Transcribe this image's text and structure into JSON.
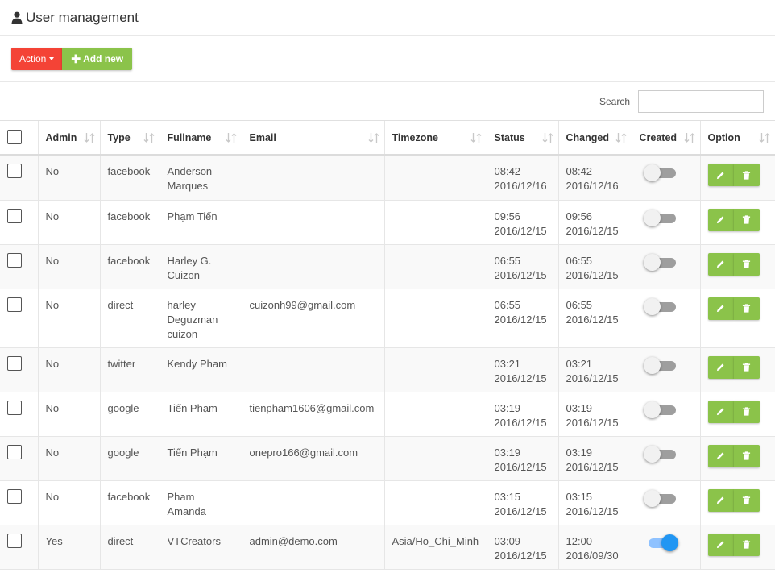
{
  "header": {
    "title": "User management",
    "icon": "user-icon"
  },
  "toolbar": {
    "action_label": "Action",
    "add_label": "Add new"
  },
  "search": {
    "label": "Search",
    "value": "",
    "placeholder": ""
  },
  "table": {
    "columns": [
      "Admin",
      "Type",
      "Fullname",
      "Email",
      "Timezone",
      "Status",
      "Changed",
      "Created",
      "Option"
    ],
    "rows": [
      {
        "admin": "No",
        "type": "facebook",
        "fullname": "Anderson Marques",
        "email": "",
        "timezone": "",
        "status_time": "08:42",
        "status_date": "2016/12/16",
        "changed_time": "08:42",
        "changed_date": "2016/12/16",
        "created": false
      },
      {
        "admin": "No",
        "type": "facebook",
        "fullname": "Phạm Tiến",
        "email": "",
        "timezone": "",
        "status_time": "09:56",
        "status_date": "2016/12/15",
        "changed_time": "09:56",
        "changed_date": "2016/12/15",
        "created": false
      },
      {
        "admin": "No",
        "type": "facebook",
        "fullname": "Harley G. Cuizon",
        "email": "",
        "timezone": "",
        "status_time": "06:55",
        "status_date": "2016/12/15",
        "changed_time": "06:55",
        "changed_date": "2016/12/15",
        "created": false
      },
      {
        "admin": "No",
        "type": "direct",
        "fullname": "harley Deguzman cuizon",
        "email": "cuizonh99@gmail.com",
        "timezone": "",
        "status_time": "06:55",
        "status_date": "2016/12/15",
        "changed_time": "06:55",
        "changed_date": "2016/12/15",
        "created": false
      },
      {
        "admin": "No",
        "type": "twitter",
        "fullname": "Kendy Pham",
        "email": "",
        "timezone": "",
        "status_time": "03:21",
        "status_date": "2016/12/15",
        "changed_time": "03:21",
        "changed_date": "2016/12/15",
        "created": false
      },
      {
        "admin": "No",
        "type": "google",
        "fullname": "Tiến Phạm",
        "email": "tienpham1606@gmail.com",
        "timezone": "",
        "status_time": "03:19",
        "status_date": "2016/12/15",
        "changed_time": "03:19",
        "changed_date": "2016/12/15",
        "created": false
      },
      {
        "admin": "No",
        "type": "google",
        "fullname": "Tiến Phạm",
        "email": "onepro166@gmail.com",
        "timezone": "",
        "status_time": "03:19",
        "status_date": "2016/12/15",
        "changed_time": "03:19",
        "changed_date": "2016/12/15",
        "created": false
      },
      {
        "admin": "No",
        "type": "facebook",
        "fullname": "Pham Amanda",
        "email": "",
        "timezone": "",
        "status_time": "03:15",
        "status_date": "2016/12/15",
        "changed_time": "03:15",
        "changed_date": "2016/12/15",
        "created": false
      },
      {
        "admin": "Yes",
        "type": "direct",
        "fullname": "VTCreators",
        "email": "admin@demo.com",
        "timezone": "Asia/Ho_Chi_Minh",
        "status_time": "03:09",
        "status_date": "2016/12/15",
        "changed_time": "12:00",
        "changed_date": "2016/09/30",
        "created": true
      }
    ]
  },
  "colors": {
    "action": "#f44336",
    "add": "#8bc34a",
    "toggle_on": "#2196f3",
    "toggle_off": "#9e9e9e"
  }
}
